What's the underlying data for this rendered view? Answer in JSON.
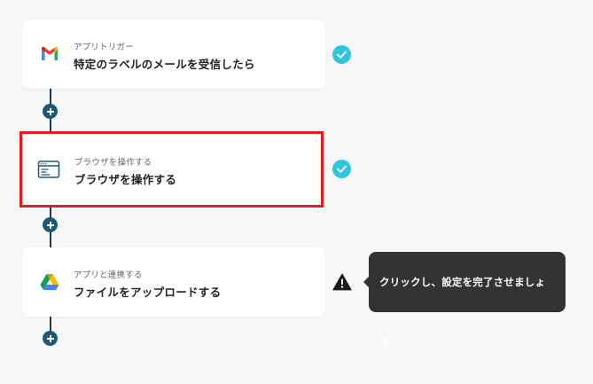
{
  "flow": {
    "steps": [
      {
        "id": "trigger",
        "subtitle": "アプリトリガー",
        "title": "特定のラベルのメールを受信したら",
        "icon": "gmail-icon",
        "status": "complete"
      },
      {
        "id": "browser",
        "subtitle": "ブラウザを操作する",
        "title": "ブラウザを操作する",
        "icon": "browser-window-icon",
        "status": "complete",
        "highlighted": true
      },
      {
        "id": "drive",
        "subtitle": "アプリと連携する",
        "title": "ファイルをアップロードする",
        "icon": "google-drive-icon",
        "status": "warning"
      }
    ]
  },
  "tooltip": {
    "text": "クリックし、設定を完了させましょう！"
  },
  "colors": {
    "background": "#f7f7f7",
    "card": "#ffffff",
    "highlight_border": "#e11d1d",
    "check": "#2ec6de",
    "add_button": "#1e5a78",
    "connector": "#1f3a52",
    "tooltip_bg": "#333333",
    "warning": "#1a1a1a"
  },
  "icons": {
    "complete": "check-circle-icon",
    "warning": "warning-triangle-icon",
    "add": "plus-circle-icon"
  }
}
